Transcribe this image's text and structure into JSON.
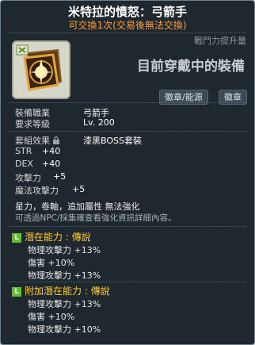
{
  "item": {
    "name": "米特拉的憤怒：弓箭手",
    "trade_note": "可交換1次(交易後無法交換)",
    "icon": "mitra-rage-emblem-icon",
    "power_label": "戰鬥力提升量",
    "equipped_label": "目前穿戴中的裝備",
    "cube_buttons": [
      "徽章/能源",
      "徽章"
    ]
  },
  "requirements": {
    "job_label": "裝備職業",
    "job_value": "弓箭手",
    "level_label": "要求等級",
    "level_value": "Lv. 200"
  },
  "set_effect": {
    "label": "套組效果",
    "value": "漆黑BOSS套裝"
  },
  "stats": [
    {
      "name": "STR",
      "value": "+40"
    },
    {
      "name": "DEX",
      "value": "+40"
    },
    {
      "name": "攻擊力",
      "value": "+5"
    },
    {
      "name": "魔法攻擊力",
      "value": "+5"
    }
  ],
  "enhance_info": "星力，卷軸，追加屬性 無法強化",
  "npc_note": "可透過NPC/採集確查看強化資訊詳細內容。",
  "potential": {
    "header": "潛在能力 : 傳說",
    "lines": [
      "物理攻擊力 +13%",
      "傷害 +10%",
      "物理攻擊力 +13%"
    ]
  },
  "additional_potential": {
    "header": "附加潛在能力 : 傳說",
    "lines": [
      "物理攻擊力 +13%",
      "傷害 +10%",
      "物理攻擊力 +10%"
    ]
  },
  "colors": {
    "panel": "#1f272f",
    "title": "#ffffff",
    "trade_note": "#ff9f2f",
    "potential_header": "#ffcc33",
    "legendary_icon": "#5fbf2e"
  }
}
